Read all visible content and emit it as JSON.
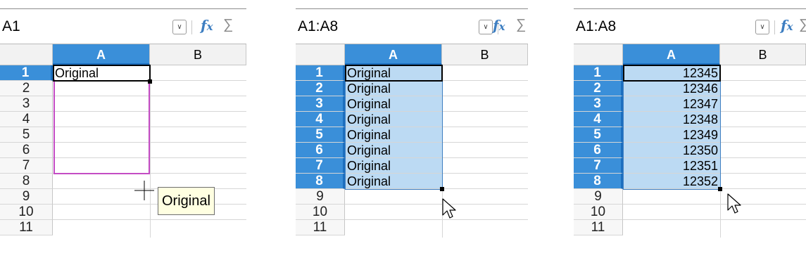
{
  "icons": {
    "dropdown": "chevron-down-icon",
    "function_wizard": "fx-icon",
    "sum": "sigma-icon"
  },
  "colors": {
    "selected_header": "#3a8fd9",
    "selection_fill": "#bcdaf3",
    "drag_outline": "#c44cc4",
    "fx": "#3d7ec1"
  },
  "panels": [
    {
      "name_box": "A1",
      "columns": [
        "A",
        "B"
      ],
      "rows": [
        "1",
        "2",
        "3",
        "4",
        "5",
        "6",
        "7",
        "8",
        "9",
        "10",
        "11"
      ],
      "cells": [
        "Original"
      ],
      "tooltip": "Original"
    },
    {
      "name_box": "A1:A8",
      "columns": [
        "A",
        "B"
      ],
      "rows": [
        "1",
        "2",
        "3",
        "4",
        "5",
        "6",
        "7",
        "8",
        "9",
        "10",
        "11"
      ],
      "cells": [
        "Original",
        "Original",
        "Original",
        "Original",
        "Original",
        "Original",
        "Original",
        "Original"
      ]
    },
    {
      "name_box": "A1:A8",
      "columns": [
        "A",
        "B"
      ],
      "rows": [
        "1",
        "2",
        "3",
        "4",
        "5",
        "6",
        "7",
        "8",
        "9",
        "10",
        "11"
      ],
      "cells": [
        "12345",
        "12346",
        "12347",
        "12348",
        "12349",
        "12350",
        "12351",
        "12352"
      ]
    }
  ]
}
